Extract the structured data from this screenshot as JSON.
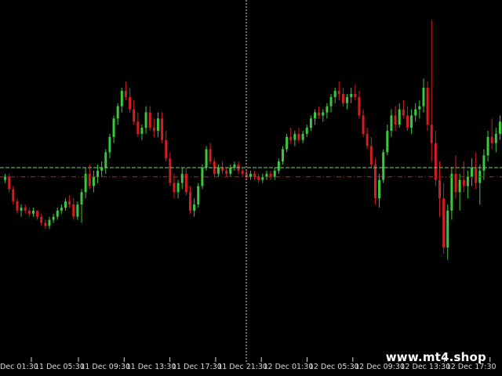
{
  "watermark": "www.mt4.shop",
  "colors": {
    "background": "#000000",
    "bull": "#3cc83c",
    "bear": "#d21e1e",
    "bid_line": "#78d278",
    "stop_line": "#c81e1e",
    "crosshair": "#d0d0d0",
    "axis_text": "#d8d8d8"
  },
  "time_axis": {
    "labels": [
      "Dec 01:30",
      "11 Dec 05:30",
      "11 Dec 09:30",
      "11 Dec 13:30",
      "11 Dec 17:30",
      "11 Dec 21:30",
      "12 Dec 01:30",
      "12 Dec 05:30",
      "12 Dec 09:30",
      "12 Dec 13:30",
      "12 Dec 17:30"
    ]
  },
  "chart_data": {
    "type": "candlestick",
    "ylim": [
      0,
      100
    ],
    "levels": {
      "bid": 50,
      "stop": 47
    },
    "series": [
      {
        "o": 46,
        "h": 48,
        "l": 45,
        "c": 47
      },
      {
        "o": 47,
        "h": 48,
        "l": 42,
        "c": 43
      },
      {
        "o": 43,
        "h": 44,
        "l": 38,
        "c": 39
      },
      {
        "o": 39,
        "h": 40,
        "l": 35,
        "c": 36
      },
      {
        "o": 36,
        "h": 38,
        "l": 34,
        "c": 37
      },
      {
        "o": 37,
        "h": 38,
        "l": 35,
        "c": 36
      },
      {
        "o": 36,
        "h": 37,
        "l": 34,
        "c": 35
      },
      {
        "o": 35,
        "h": 37,
        "l": 34,
        "c": 36
      },
      {
        "o": 36,
        "h": 36,
        "l": 33,
        "c": 34
      },
      {
        "o": 34,
        "h": 35,
        "l": 31,
        "c": 32
      },
      {
        "o": 32,
        "h": 33,
        "l": 30,
        "c": 31
      },
      {
        "o": 31,
        "h": 34,
        "l": 30,
        "c": 33
      },
      {
        "o": 33,
        "h": 35,
        "l": 32,
        "c": 34
      },
      {
        "o": 34,
        "h": 37,
        "l": 33,
        "c": 36
      },
      {
        "o": 36,
        "h": 38,
        "l": 35,
        "c": 37
      },
      {
        "o": 37,
        "h": 40,
        "l": 36,
        "c": 39
      },
      {
        "o": 39,
        "h": 41,
        "l": 37,
        "c": 38
      },
      {
        "o": 38,
        "h": 40,
        "l": 33,
        "c": 34
      },
      {
        "o": 34,
        "h": 39,
        "l": 33,
        "c": 38
      },
      {
        "o": 38,
        "h": 43,
        "l": 32,
        "c": 42
      },
      {
        "o": 42,
        "h": 50,
        "l": 40,
        "c": 48
      },
      {
        "o": 48,
        "h": 51,
        "l": 43,
        "c": 44
      },
      {
        "o": 44,
        "h": 49,
        "l": 42,
        "c": 47
      },
      {
        "o": 47,
        "h": 51,
        "l": 45,
        "c": 49
      },
      {
        "o": 49,
        "h": 52,
        "l": 47,
        "c": 50
      },
      {
        "o": 50,
        "h": 56,
        "l": 48,
        "c": 55
      },
      {
        "o": 55,
        "h": 61,
        "l": 53,
        "c": 60
      },
      {
        "o": 60,
        "h": 67,
        "l": 58,
        "c": 66
      },
      {
        "o": 66,
        "h": 71,
        "l": 64,
        "c": 70
      },
      {
        "o": 70,
        "h": 76,
        "l": 68,
        "c": 75
      },
      {
        "o": 75,
        "h": 78,
        "l": 72,
        "c": 73
      },
      {
        "o": 73,
        "h": 76,
        "l": 68,
        "c": 69
      },
      {
        "o": 69,
        "h": 72,
        "l": 64,
        "c": 65
      },
      {
        "o": 65,
        "h": 68,
        "l": 60,
        "c": 61
      },
      {
        "o": 61,
        "h": 64,
        "l": 59,
        "c": 63
      },
      {
        "o": 63,
        "h": 70,
        "l": 61,
        "c": 68
      },
      {
        "o": 68,
        "h": 70,
        "l": 62,
        "c": 63
      },
      {
        "o": 63,
        "h": 66,
        "l": 60,
        "c": 62
      },
      {
        "o": 62,
        "h": 68,
        "l": 60,
        "c": 66
      },
      {
        "o": 66,
        "h": 68,
        "l": 58,
        "c": 59
      },
      {
        "o": 59,
        "h": 62,
        "l": 52,
        "c": 53
      },
      {
        "o": 53,
        "h": 55,
        "l": 44,
        "c": 45
      },
      {
        "o": 45,
        "h": 48,
        "l": 40,
        "c": 42
      },
      {
        "o": 42,
        "h": 46,
        "l": 40,
        "c": 45
      },
      {
        "o": 45,
        "h": 50,
        "l": 43,
        "c": 48
      },
      {
        "o": 48,
        "h": 50,
        "l": 41,
        "c": 42
      },
      {
        "o": 42,
        "h": 44,
        "l": 35,
        "c": 36
      },
      {
        "o": 36,
        "h": 40,
        "l": 34,
        "c": 38
      },
      {
        "o": 38,
        "h": 45,
        "l": 37,
        "c": 44
      },
      {
        "o": 44,
        "h": 51,
        "l": 43,
        "c": 50
      },
      {
        "o": 50,
        "h": 57,
        "l": 49,
        "c": 56
      },
      {
        "o": 56,
        "h": 58,
        "l": 51,
        "c": 52
      },
      {
        "o": 52,
        "h": 53,
        "l": 47,
        "c": 48
      },
      {
        "o": 48,
        "h": 51,
        "l": 47,
        "c": 50
      },
      {
        "o": 50,
        "h": 52,
        "l": 48,
        "c": 49
      },
      {
        "o": 49,
        "h": 50,
        "l": 47,
        "c": 48
      },
      {
        "o": 48,
        "h": 51,
        "l": 47,
        "c": 50
      },
      {
        "o": 50,
        "h": 52,
        "l": 49,
        "c": 51
      },
      {
        "o": 51,
        "h": 52,
        "l": 48,
        "c": 49
      },
      {
        "o": 49,
        "h": 50,
        "l": 47,
        "c": 48
      },
      {
        "o": 48,
        "h": 49,
        "l": 46,
        "c": 47
      },
      {
        "o": 47,
        "h": 49,
        "l": 46,
        "c": 48
      },
      {
        "o": 48,
        "h": 49,
        "l": 46,
        "c": 47
      },
      {
        "o": 47,
        "h": 48,
        "l": 45,
        "c": 46
      },
      {
        "o": 46,
        "h": 48,
        "l": 45,
        "c": 47
      },
      {
        "o": 47,
        "h": 49,
        "l": 46,
        "c": 48
      },
      {
        "o": 48,
        "h": 49,
        "l": 46,
        "c": 47
      },
      {
        "o": 47,
        "h": 50,
        "l": 46,
        "c": 49
      },
      {
        "o": 49,
        "h": 53,
        "l": 48,
        "c": 52
      },
      {
        "o": 52,
        "h": 57,
        "l": 51,
        "c": 56
      },
      {
        "o": 56,
        "h": 61,
        "l": 55,
        "c": 60
      },
      {
        "o": 60,
        "h": 63,
        "l": 58,
        "c": 59
      },
      {
        "o": 59,
        "h": 62,
        "l": 57,
        "c": 61
      },
      {
        "o": 61,
        "h": 63,
        "l": 58,
        "c": 59
      },
      {
        "o": 59,
        "h": 62,
        "l": 58,
        "c": 61
      },
      {
        "o": 61,
        "h": 64,
        "l": 60,
        "c": 63
      },
      {
        "o": 63,
        "h": 67,
        "l": 62,
        "c": 66
      },
      {
        "o": 66,
        "h": 69,
        "l": 64,
        "c": 68
      },
      {
        "o": 68,
        "h": 70,
        "l": 66,
        "c": 67
      },
      {
        "o": 67,
        "h": 69,
        "l": 65,
        "c": 68
      },
      {
        "o": 68,
        "h": 71,
        "l": 66,
        "c": 70
      },
      {
        "o": 70,
        "h": 74,
        "l": 68,
        "c": 73
      },
      {
        "o": 73,
        "h": 76,
        "l": 71,
        "c": 75
      },
      {
        "o": 75,
        "h": 78,
        "l": 72,
        "c": 74
      },
      {
        "o": 74,
        "h": 76,
        "l": 70,
        "c": 71
      },
      {
        "o": 71,
        "h": 74,
        "l": 69,
        "c": 73
      },
      {
        "o": 73,
        "h": 76,
        "l": 71,
        "c": 74
      },
      {
        "o": 74,
        "h": 77,
        "l": 72,
        "c": 73
      },
      {
        "o": 73,
        "h": 75,
        "l": 66,
        "c": 67
      },
      {
        "o": 67,
        "h": 69,
        "l": 60,
        "c": 61
      },
      {
        "o": 61,
        "h": 63,
        "l": 56,
        "c": 57
      },
      {
        "o": 57,
        "h": 60,
        "l": 50,
        "c": 51
      },
      {
        "o": 51,
        "h": 53,
        "l": 38,
        "c": 40
      },
      {
        "o": 40,
        "h": 48,
        "l": 37,
        "c": 46
      },
      {
        "o": 46,
        "h": 56,
        "l": 45,
        "c": 55
      },
      {
        "o": 55,
        "h": 64,
        "l": 54,
        "c": 62
      },
      {
        "o": 62,
        "h": 69,
        "l": 60,
        "c": 67
      },
      {
        "o": 67,
        "h": 70,
        "l": 62,
        "c": 64
      },
      {
        "o": 64,
        "h": 71,
        "l": 63,
        "c": 69
      },
      {
        "o": 69,
        "h": 72,
        "l": 66,
        "c": 67
      },
      {
        "o": 67,
        "h": 70,
        "l": 62,
        "c": 63
      },
      {
        "o": 63,
        "h": 69,
        "l": 61,
        "c": 67
      },
      {
        "o": 67,
        "h": 71,
        "l": 65,
        "c": 69
      },
      {
        "o": 69,
        "h": 72,
        "l": 66,
        "c": 70
      },
      {
        "o": 70,
        "h": 79,
        "l": 68,
        "c": 76
      },
      {
        "o": 76,
        "h": 78,
        "l": 62,
        "c": 64
      },
      {
        "o": 64,
        "h": 98,
        "l": 52,
        "c": 58
      },
      {
        "o": 58,
        "h": 62,
        "l": 44,
        "c": 46
      },
      {
        "o": 46,
        "h": 52,
        "l": 34,
        "c": 40
      },
      {
        "o": 40,
        "h": 45,
        "l": 22,
        "c": 24
      },
      {
        "o": 24,
        "h": 38,
        "l": 20,
        "c": 36
      },
      {
        "o": 36,
        "h": 50,
        "l": 33,
        "c": 48
      },
      {
        "o": 48,
        "h": 54,
        "l": 40,
        "c": 42
      },
      {
        "o": 42,
        "h": 48,
        "l": 36,
        "c": 46
      },
      {
        "o": 46,
        "h": 52,
        "l": 42,
        "c": 44
      },
      {
        "o": 44,
        "h": 49,
        "l": 40,
        "c": 47
      },
      {
        "o": 47,
        "h": 53,
        "l": 44,
        "c": 50
      },
      {
        "o": 50,
        "h": 55,
        "l": 43,
        "c": 45
      },
      {
        "o": 45,
        "h": 51,
        "l": 38,
        "c": 49
      },
      {
        "o": 49,
        "h": 56,
        "l": 46,
        "c": 54
      },
      {
        "o": 54,
        "h": 62,
        "l": 52,
        "c": 60
      },
      {
        "o": 60,
        "h": 66,
        "l": 56,
        "c": 58
      },
      {
        "o": 58,
        "h": 63,
        "l": 55,
        "c": 61
      },
      {
        "o": 61,
        "h": 67,
        "l": 59,
        "c": 65
      }
    ]
  }
}
